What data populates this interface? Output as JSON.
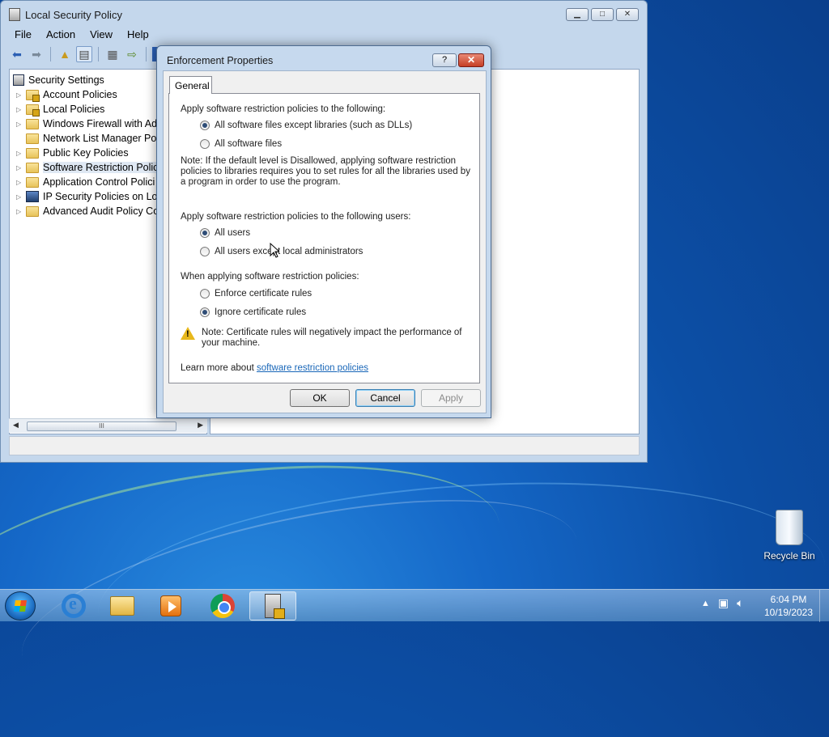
{
  "main_window": {
    "title": "Local Security Policy",
    "menu": [
      "File",
      "Action",
      "View",
      "Help"
    ],
    "tree": [
      {
        "label": "Security Settings",
        "icon": "security-settings-icon",
        "expander": false
      },
      {
        "label": "Account Policies",
        "icon": "folder-lock-icon",
        "expander": true
      },
      {
        "label": "Local Policies",
        "icon": "folder-lock-icon",
        "expander": true
      },
      {
        "label": "Windows Firewall with Ad",
        "icon": "folder-icon",
        "expander": true
      },
      {
        "label": "Network List Manager Pol",
        "icon": "folder-icon",
        "expander": false
      },
      {
        "label": "Public Key Policies",
        "icon": "folder-icon",
        "expander": true
      },
      {
        "label": "Software Restriction Polici",
        "icon": "folder-icon",
        "expander": true,
        "selected": true
      },
      {
        "label": "Application Control Polici",
        "icon": "folder-icon",
        "expander": true
      },
      {
        "label": "IP Security Policies on Loc",
        "icon": "ip-security-icon",
        "expander": true
      },
      {
        "label": "Advanced Audit Policy Co",
        "icon": "folder-icon",
        "expander": true
      }
    ],
    "scroll_thumb": "III"
  },
  "dialog": {
    "title": "Enforcement Properties",
    "help_label": "?",
    "close_label": "✕",
    "tab": "General",
    "section1": "Apply software restriction policies to the following:",
    "opt_except_libs": "All software files except libraries (such as DLLs)",
    "opt_all_files": "All software files",
    "note1": "Note:  If the default level is Disallowed, applying software restriction policies to libraries requires you to set rules for all the libraries used by a program in order to use the program.",
    "section2": "Apply software restriction policies to the following users:",
    "opt_all_users": "All users",
    "opt_except_admins": "All users except local administrators",
    "section3": "When applying software restriction policies:",
    "opt_enforce_cert": "Enforce certificate rules",
    "opt_ignore_cert": "Ignore certificate rules",
    "note2": "Note:  Certificate rules will negatively impact the performance of your machine.",
    "learn_prefix": "Learn more about ",
    "learn_link": "software restriction policies",
    "ok": "OK",
    "cancel": "Cancel",
    "apply": "Apply",
    "selected": {
      "files": "except_libraries",
      "users": "all_users",
      "certificates": "ignore"
    }
  },
  "desktop": {
    "recycle_bin": "Recycle Bin"
  },
  "taskbar": {
    "apps": [
      "internet-explorer",
      "windows-explorer",
      "media-player",
      "chrome",
      "local-security-policy"
    ],
    "time": "6:04 PM",
    "date": "10/19/2023"
  }
}
